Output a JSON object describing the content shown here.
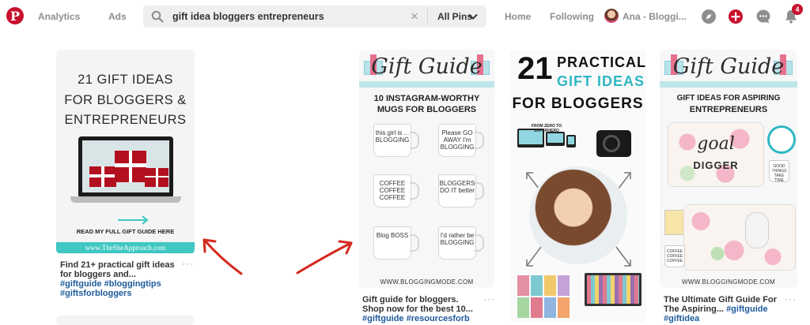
{
  "header": {
    "logo": "P",
    "nav_analytics": "Analytics",
    "nav_ads": "Ads",
    "search_value": "gift idea bloggers entrepreneurs",
    "clear_glyph": "×",
    "filter_label": "All Pins",
    "nav_home": "Home",
    "nav_following": "Following",
    "user_name": "Ana - Bloggi...",
    "notification_count": "4",
    "colors": {
      "brand": "#c8102e",
      "muted": "#8e8e8e",
      "search_bg": "#efefef"
    },
    "icons": [
      "search-icon",
      "clear-icon",
      "chevron-down-icon",
      "compass-icon",
      "plus-icon",
      "chat-icon",
      "bell-icon"
    ]
  },
  "pins": [
    {
      "title_lines": [
        "21 GIFT IDEAS",
        "FOR BLOGGERS &",
        "ENTREPRENEURS"
      ],
      "cta": "READ MY FULL GIFT GUIDE HERE",
      "site": "www.TheSheApproach.com",
      "desc_text": "Find 21+ practical gift ideas for bloggers and...",
      "desc_tags": "#giftguide #bloggingtips #giftsforbloggers",
      "more": "···"
    },
    {
      "script_title": "Gift Guide",
      "subtitle_lines": [
        "10 INSTAGRAM-WORTHY",
        "MUGS FOR BLOGGERS"
      ],
      "mugs": [
        "this girl is ... BLOGGING",
        "Please GO AWAY I'm BLOGGING",
        "COFFEE COFFEE COFFEE",
        "BLOGGERS DO IT better",
        "Blog BOSS",
        "I'd rather be BLOGGING"
      ],
      "site": "WWW.BLOGGINGMODE.COM",
      "desc_text": "Gift guide for bloggers. Shop now for the best 10...",
      "desc_tags": "#giftguide #resourcesforb",
      "more": "···"
    },
    {
      "number": "21",
      "line1": "PRACTICAL",
      "line2": "GIFT IDEAS",
      "line3": "FOR BLOGGERS",
      "course_label": "FROM ZERO TO SUPERHERO",
      "colors": {
        "accent": "#2fb8c2"
      }
    },
    {
      "script_title": "Gift Guide",
      "subtitle_line1": "GIFT IDEAS FOR ASPIRING",
      "subtitle_line2": "ENTREPRENEURS",
      "case_word1": "goal",
      "case_word2": "DIGGER",
      "small_mug_text": "COFFEE COFFEE COFFEE",
      "side_mug_text": "GOOD THINGS TAKE TIME",
      "site": "WWW.BLOGGINGMODE.COM",
      "desc_text": "The Ultimate Gift Guide For The Aspiring...",
      "desc_tags": "#giftguide #giftidea",
      "more": "···"
    }
  ],
  "annotations": {
    "arrow_color": "#d42a1f"
  }
}
